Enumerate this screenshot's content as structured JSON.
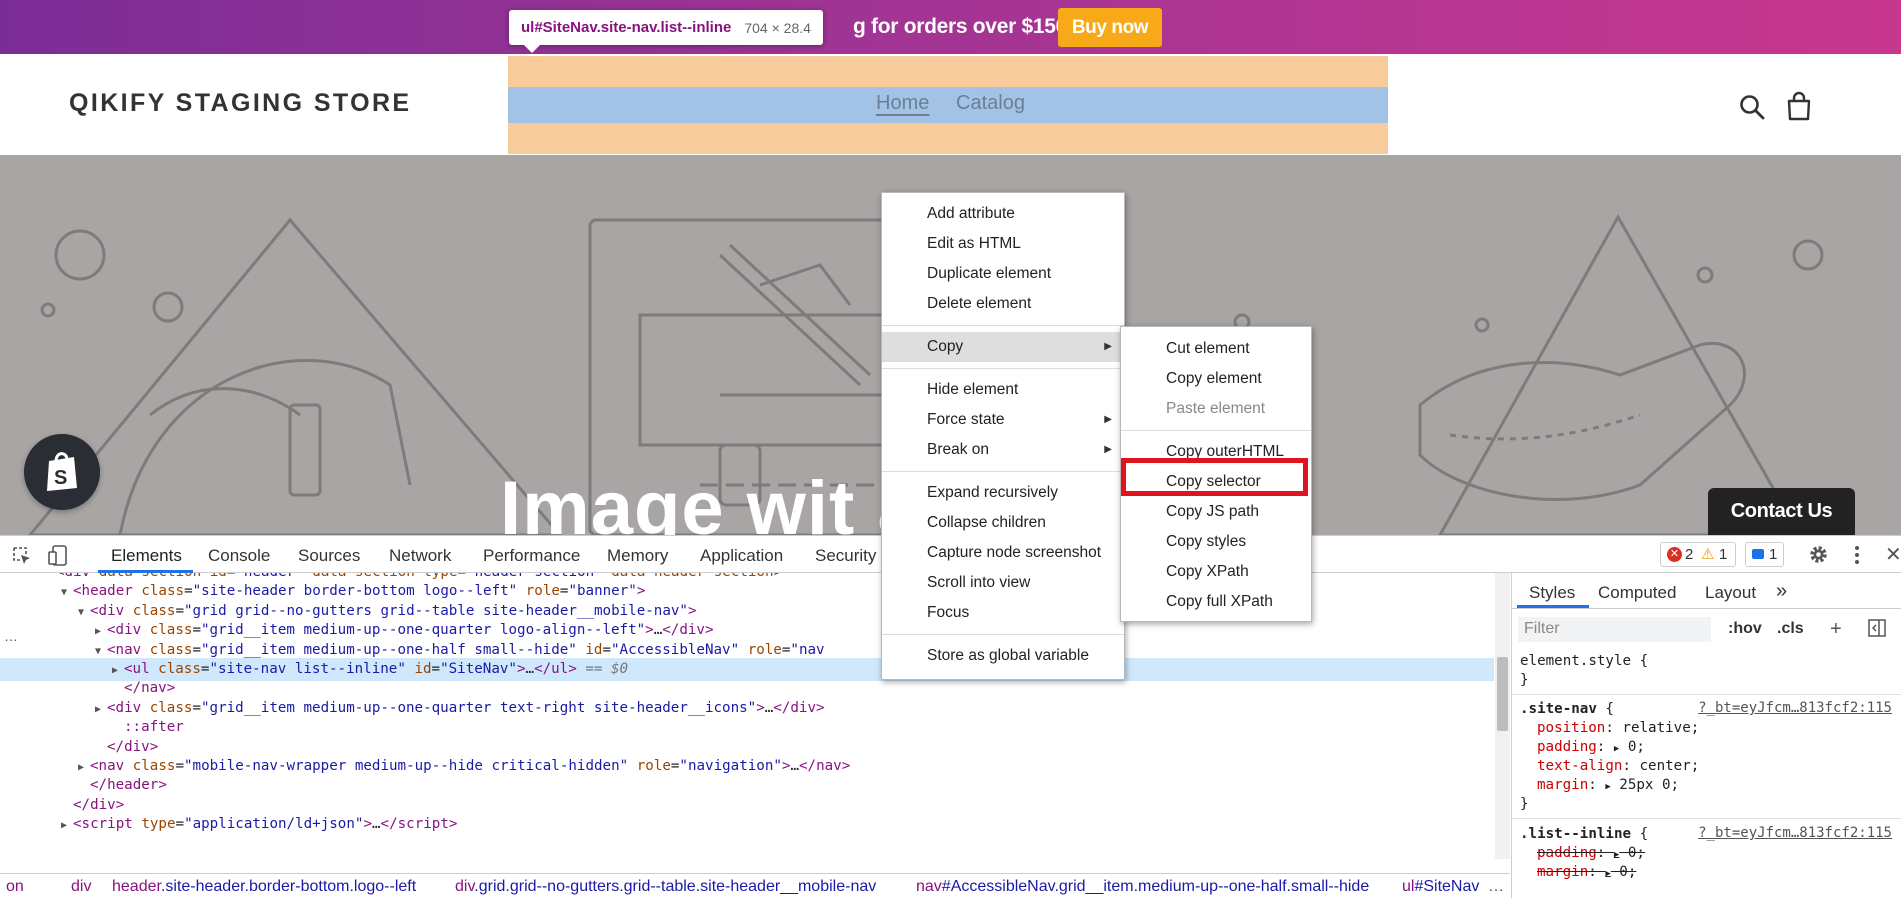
{
  "announcement": {
    "text": "g for orders over $150",
    "button": "Buy now"
  },
  "inspect_tooltip": {
    "selector": "ul#SiteNav.site-nav.list--inline",
    "size": "704 × 28.4"
  },
  "store": {
    "title": "QIKIFY STAGING STORE",
    "nav": [
      "Home",
      "Catalog"
    ]
  },
  "hero": {
    "heading": "Image wit                      av"
  },
  "contact": "Contact Us",
  "devtools": {
    "tabs": [
      "Elements",
      "Console",
      "Sources",
      "Network",
      "Performance",
      "Memory",
      "Application",
      "Security"
    ],
    "errors": "2",
    "warnings": "1",
    "messages": "1",
    "dom": [
      {
        "indent": 0,
        "tri": "",
        "html": "<span class='tag'>&lt;div</span> <span class='attr'>data-section-id</span>=<span class='val'>\"header\"</span> <span class='attr'>data-section-type</span>=<span class='val'>\"header-section\"</span> <span class='attr'>data-header-section</span><span class='tag'>&gt;</span>"
      },
      {
        "indent": 1,
        "tri": "▼",
        "html": "<span class='tag'>&lt;header</span> <span class='attr'>class</span>=<span class='val'>\"site-header border-bottom logo--left\"</span> <span class='attr'>role</span>=<span class='val'>\"banner\"</span><span class='tag'>&gt;</span>"
      },
      {
        "indent": 2,
        "tri": "▼",
        "html": "<span class='tag'>&lt;div</span> <span class='attr'>class</span>=<span class='val'>\"grid grid--no-gutters grid--table site-header__mobile-nav\"</span><span class='tag'>&gt;</span>"
      },
      {
        "indent": 3,
        "tri": "▶",
        "html": "<span class='tag'>&lt;div</span> <span class='attr'>class</span>=<span class='val'>\"grid__item medium-up--one-quarter logo-align--left\"</span><span class='tag'>&gt;</span>…<span class='tag'>&lt;/div&gt;</span>"
      },
      {
        "indent": 3,
        "tri": "▼",
        "html": "<span class='tag'>&lt;nav</span> <span class='attr'>class</span>=<span class='val'>\"grid__item medium-up--one-half small--hide\"</span> <span class='attr'>id</span>=<span class='val'>\"AccessibleNav\"</span> <span class='attr'>role</span>=<span class='val'>\"nav</span>"
      },
      {
        "indent": 4,
        "tri": "▶",
        "html": "<span class='tag'>&lt;ul</span> <span class='attr'>class</span>=<span class='val'>\"site-nav list--inline\"</span> <span class='attr'>id</span>=<span class='val'>\"SiteNav\"</span><span class='tag'>&gt;</span>…<span class='tag'>&lt;/ul&gt;</span> <span class='dim'>== $0</span>",
        "selected": true
      },
      {
        "indent": 4,
        "tri": "",
        "html": "<span class='tag'>&lt;/nav&gt;</span>"
      },
      {
        "indent": 3,
        "tri": "▶",
        "html": "<span class='tag'>&lt;div</span> <span class='attr'>class</span>=<span class='val'>\"grid__item medium-up--one-quarter text-right site-header__icons\"</span><span class='tag'>&gt;</span>…<span class='tag'>&lt;/div&gt;</span>"
      },
      {
        "indent": 4,
        "tri": "",
        "html": "<span class='pseudo'>::after</span>"
      },
      {
        "indent": 3,
        "tri": "",
        "html": "<span class='tag'>&lt;/div&gt;</span>"
      },
      {
        "indent": 2,
        "tri": "▶",
        "html": "<span class='tag'>&lt;nav</span> <span class='attr'>class</span>=<span class='val'>\"mobile-nav-wrapper medium-up--hide critical-hidden\"</span> <span class='attr'>role</span>=<span class='val'>\"navigation\"</span><span class='tag'>&gt;</span>…<span class='tag'>&lt;/nav&gt;</span>"
      },
      {
        "indent": 2,
        "tri": "",
        "html": "<span class='tag'>&lt;/header&gt;</span>"
      },
      {
        "indent": 1,
        "tri": "",
        "html": "<span class='tag'>&lt;/div&gt;</span>"
      },
      {
        "indent": 1,
        "tri": "▶",
        "html": "<span class='tag'>&lt;script</span> <span class='attr'>type</span>=<span class='val'>\"application/ld+json\"</span><span class='tag'>&gt;</span>…<span class='tag'>&lt;/script&gt;</span>"
      }
    ],
    "breadcrumbs": [
      {
        "tag": "on",
        "cls": ""
      },
      {
        "tag": "div",
        "cls": ""
      },
      {
        "tag": "header",
        "cls": ".site-header.border-bottom.logo--left"
      },
      {
        "tag": "div",
        "cls": ".grid.grid--no-gutters.grid--table.site-header__mobile-nav"
      },
      {
        "tag": "nav",
        "cls": "#AccessibleNav.grid__item.medium-up--one-half.small--hide"
      },
      {
        "tag": "ul",
        "cls": "#SiteNav"
      }
    ],
    "styles_tabs": [
      "Styles",
      "Computed",
      "Layout",
      "»"
    ],
    "filter_placeholder": "Filter",
    "hov": ":hov",
    "cls": ".cls",
    "css_source": "?_bt=eyJfcm…813fcf2:115"
  },
  "context_menu": {
    "main": [
      {
        "label": "Add attribute"
      },
      {
        "label": "Edit as HTML"
      },
      {
        "label": "Duplicate element"
      },
      {
        "label": "Delete element"
      },
      {
        "sep": true
      },
      {
        "label": "Copy",
        "submenu": true,
        "active": true
      },
      {
        "sep": true
      },
      {
        "label": "Hide element"
      },
      {
        "label": "Force state",
        "submenu": true
      },
      {
        "label": "Break on",
        "submenu": true
      },
      {
        "sep": true
      },
      {
        "label": "Expand recursively"
      },
      {
        "label": "Collapse children"
      },
      {
        "label": "Capture node screenshot"
      },
      {
        "label": "Scroll into view"
      },
      {
        "label": "Focus"
      },
      {
        "sep": true
      },
      {
        "label": "Store as global variable"
      }
    ],
    "copy": [
      {
        "label": "Cut element"
      },
      {
        "label": "Copy element"
      },
      {
        "label": "Paste element",
        "disabled": true
      },
      {
        "sep": true
      },
      {
        "label": "Copy outerHTML"
      },
      {
        "label": "Copy selector",
        "highlighted": true
      },
      {
        "label": "Copy JS path"
      },
      {
        "label": "Copy styles"
      },
      {
        "label": "Copy XPath"
      },
      {
        "label": "Copy full XPath"
      }
    ]
  },
  "colors": {
    "announcement_start": "#7b2d96",
    "announcement_end": "#c8378e",
    "buy_button": "#f7a91a",
    "devtools_accent": "#1a73e8",
    "highlight_box": "#e0141e"
  }
}
